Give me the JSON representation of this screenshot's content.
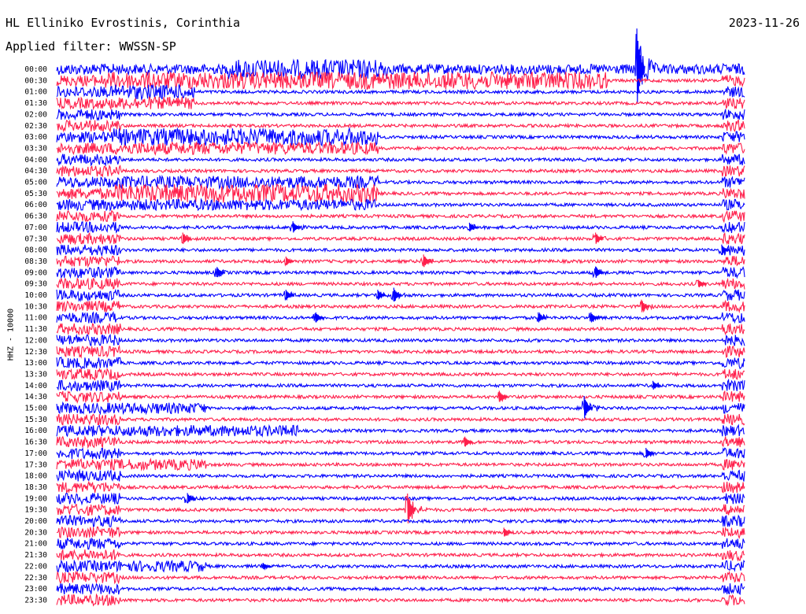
{
  "header": {
    "station": "HL Elliniko Evrostinis, Corinthia",
    "date": "2023-11-26",
    "filter_label": "Applied filter: WWSSN-SP"
  },
  "colors": {
    "trace_a": "#0000ff",
    "trace_b": "#ff1f4b",
    "axis": "#000000",
    "background": "#ffffff"
  },
  "chart_data": {
    "type": "line",
    "ylabel": "HHZ - 10000",
    "x_unit": "minutes within 30-minute row",
    "xlim": [
      0,
      30
    ],
    "row_minutes": 30,
    "rows": [
      "00:00",
      "00:30",
      "01:00",
      "01:30",
      "02:00",
      "02:30",
      "03:00",
      "03:30",
      "04:00",
      "04:30",
      "05:00",
      "05:30",
      "06:00",
      "06:30",
      "07:00",
      "07:30",
      "08:00",
      "08:30",
      "09:00",
      "09:30",
      "10:00",
      "10:30",
      "11:00",
      "11:30",
      "12:00",
      "12:30",
      "13:00",
      "13:30",
      "14:00",
      "14:30",
      "15:00",
      "15:30",
      "16:00",
      "16:30",
      "17:00",
      "17:30",
      "18:00",
      "18:30",
      "19:00",
      "19:30",
      "20:00",
      "20:30",
      "21:00",
      "21:30",
      "22:00",
      "22:30",
      "23:00",
      "23:30"
    ],
    "series_colors_alternating": [
      "#0000ff",
      "#ff1f4b"
    ],
    "noisy_segments": [
      {
        "row": "00:00",
        "start": 0,
        "end": 30,
        "level": 0.8
      },
      {
        "row": "00:00",
        "start": 7.5,
        "end": 14.5,
        "level": 1.6
      },
      {
        "row": "00:30",
        "start": 2,
        "end": 24,
        "level": 1.4
      },
      {
        "row": "01:00",
        "start": 2.5,
        "end": 6,
        "level": 1.2
      },
      {
        "row": "01:30",
        "start": 2.5,
        "end": 6,
        "level": 1.0
      },
      {
        "row": "03:00",
        "start": 2.5,
        "end": 14,
        "level": 1.4
      },
      {
        "row": "03:30",
        "start": 2.5,
        "end": 14,
        "level": 1.0
      },
      {
        "row": "05:00",
        "start": 2.5,
        "end": 14,
        "level": 1.0
      },
      {
        "row": "05:30",
        "start": 2.5,
        "end": 14,
        "level": 1.5
      },
      {
        "row": "06:00",
        "start": 2.5,
        "end": 14,
        "level": 0.9
      },
      {
        "row": "15:00",
        "start": 2.5,
        "end": 6.5,
        "level": 0.9
      },
      {
        "row": "16:00",
        "start": 2.5,
        "end": 10.5,
        "level": 0.9
      },
      {
        "row": "17:30",
        "start": 2.5,
        "end": 6.5,
        "level": 0.9
      },
      {
        "row": "22:00",
        "start": 2.5,
        "end": 6.5,
        "level": 0.9
      }
    ],
    "events": [
      {
        "row": "00:00",
        "minute": 25.3,
        "amp": 6.0
      },
      {
        "row": "07:00",
        "minute": 10.3,
        "amp": 0.9
      },
      {
        "row": "07:00",
        "minute": 18.0,
        "amp": 0.7
      },
      {
        "row": "07:30",
        "minute": 5.5,
        "amp": 0.9
      },
      {
        "row": "07:30",
        "minute": 23.5,
        "amp": 0.9
      },
      {
        "row": "08:00",
        "minute": 29.0,
        "amp": 0.8
      },
      {
        "row": "08:30",
        "minute": 10.0,
        "amp": 0.7
      },
      {
        "row": "08:30",
        "minute": 16.0,
        "amp": 1.0
      },
      {
        "row": "09:00",
        "minute": 7.0,
        "amp": 0.8
      },
      {
        "row": "09:00",
        "minute": 23.5,
        "amp": 0.9
      },
      {
        "row": "09:30",
        "minute": 28.0,
        "amp": 0.6
      },
      {
        "row": "10:00",
        "minute": 10.0,
        "amp": 0.8
      },
      {
        "row": "10:00",
        "minute": 14.0,
        "amp": 0.8
      },
      {
        "row": "10:00",
        "minute": 14.7,
        "amp": 1.1
      },
      {
        "row": "10:30",
        "minute": 25.5,
        "amp": 1.0
      },
      {
        "row": "11:00",
        "minute": 11.3,
        "amp": 0.8
      },
      {
        "row": "11:00",
        "minute": 21.0,
        "amp": 0.8
      },
      {
        "row": "11:00",
        "minute": 23.3,
        "amp": 0.8
      },
      {
        "row": "14:00",
        "minute": 26.0,
        "amp": 0.7
      },
      {
        "row": "14:30",
        "minute": 19.3,
        "amp": 0.9
      },
      {
        "row": "15:00",
        "minute": 23.0,
        "amp": 1.8
      },
      {
        "row": "16:30",
        "minute": 17.8,
        "amp": 0.8
      },
      {
        "row": "17:00",
        "minute": 25.7,
        "amp": 0.8
      },
      {
        "row": "19:00",
        "minute": 5.7,
        "amp": 0.8
      },
      {
        "row": "19:30",
        "minute": 15.3,
        "amp": 2.4
      },
      {
        "row": "20:30",
        "minute": 19.5,
        "amp": 0.7
      },
      {
        "row": "22:00",
        "minute": 9.0,
        "amp": 0.5
      }
    ]
  }
}
